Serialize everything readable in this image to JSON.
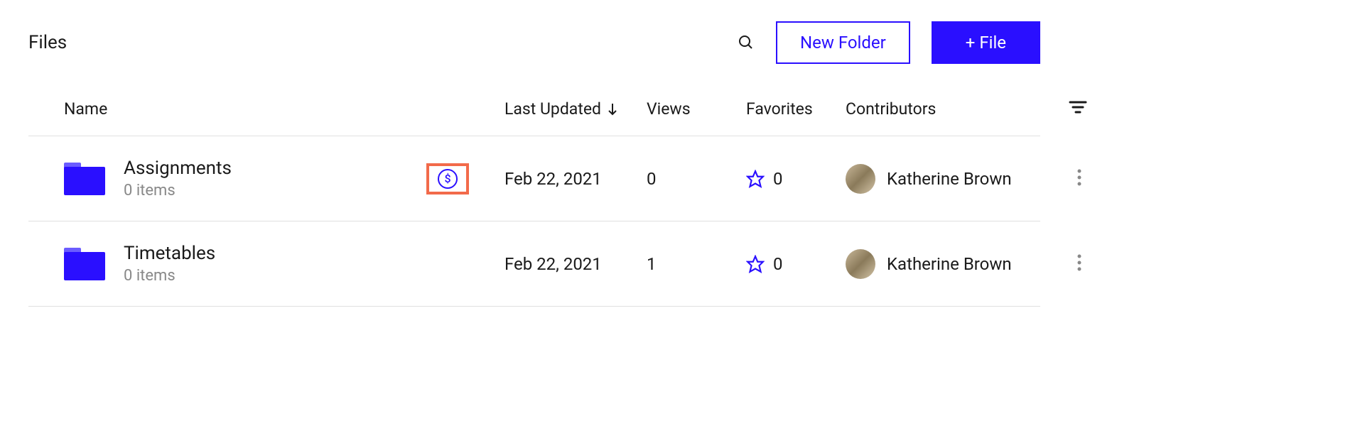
{
  "header": {
    "title": "Files",
    "new_folder_label": "New Folder",
    "new_file_label": "+ File"
  },
  "columns": {
    "name": "Name",
    "last_updated": "Last Updated",
    "views": "Views",
    "favorites": "Favorites",
    "contributors": "Contributors"
  },
  "rows": [
    {
      "name": "Assignments",
      "items_label": "0 items",
      "has_dollar_badge": true,
      "last_updated": "Feb 22, 2021",
      "views": "0",
      "favorites": "0",
      "contributor": "Katherine Brown"
    },
    {
      "name": "Timetables",
      "items_label": "0 items",
      "has_dollar_badge": false,
      "last_updated": "Feb 22, 2021",
      "views": "1",
      "favorites": "0",
      "contributor": "Katherine Brown"
    }
  ]
}
